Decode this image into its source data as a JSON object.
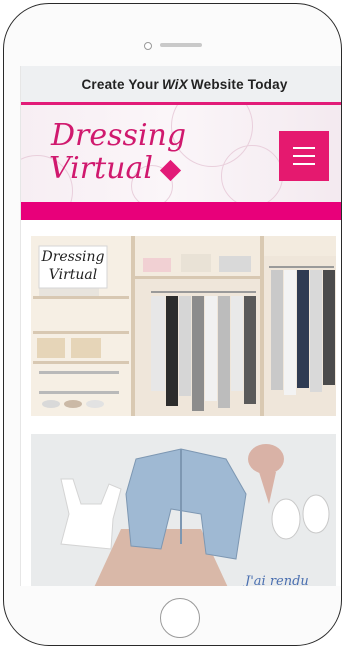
{
  "banner": {
    "prefix": "Create Your",
    "brand": "WiX",
    "suffix": "Website Today"
  },
  "site": {
    "logo_line1": "Dressing",
    "logo_line2": "Virtual",
    "accent_color": "#e5196f"
  },
  "images": {
    "closet_sign_line1": "Dressing",
    "closet_sign_line2": "Virtual",
    "outfit_caption": "J'ai rendu"
  },
  "icons": {
    "menu": "hamburger-icon",
    "home": "home-button-icon"
  }
}
